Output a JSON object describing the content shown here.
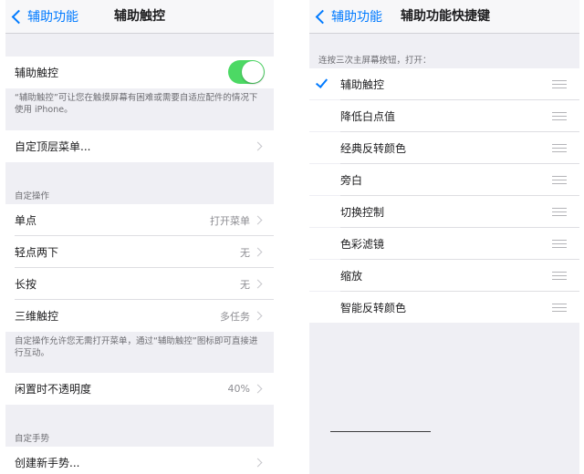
{
  "left": {
    "nav": {
      "back_label": "辅助功能",
      "title": "辅助触控"
    },
    "toggle_row": {
      "label": "辅助触控",
      "on": true
    },
    "toggle_note": "“辅助触控”可让您在触摸屏幕有困难或需要自适应配件的情况下使用 iPhone。",
    "custom_top_menu": "自定顶层菜单...",
    "custom_actions_header": "自定操作",
    "actions": [
      {
        "label": "单点",
        "value": "打开菜单"
      },
      {
        "label": "轻点两下",
        "value": "无"
      },
      {
        "label": "长按",
        "value": "无"
      },
      {
        "label": "三维触控",
        "value": "多任务"
      }
    ],
    "actions_note": "自定操作允许您无需打开菜单，通过“辅助触控”图标即可直接进行互动。",
    "idle_opacity": {
      "label": "闲置时不透明度",
      "value": "40%"
    },
    "custom_gestures_header": "自定手势",
    "create_gesture": "创建新手势..."
  },
  "right": {
    "nav": {
      "back_label": "辅助功能",
      "title": "辅助功能快捷键"
    },
    "section_header": "连按三次主屏幕按钮，打开：",
    "items": [
      {
        "label": "辅助触控",
        "checked": true
      },
      {
        "label": "降低白点值",
        "checked": false
      },
      {
        "label": "经典反转颜色",
        "checked": false
      },
      {
        "label": "旁白",
        "checked": false
      },
      {
        "label": "切换控制",
        "checked": false
      },
      {
        "label": "色彩滤镜",
        "checked": false
      },
      {
        "label": "缩放",
        "checked": false
      },
      {
        "label": "智能反转颜色",
        "checked": false
      }
    ]
  },
  "colors": {
    "accent": "#007aff",
    "toggle_on": "#4cd964",
    "background": "#efeff4"
  }
}
